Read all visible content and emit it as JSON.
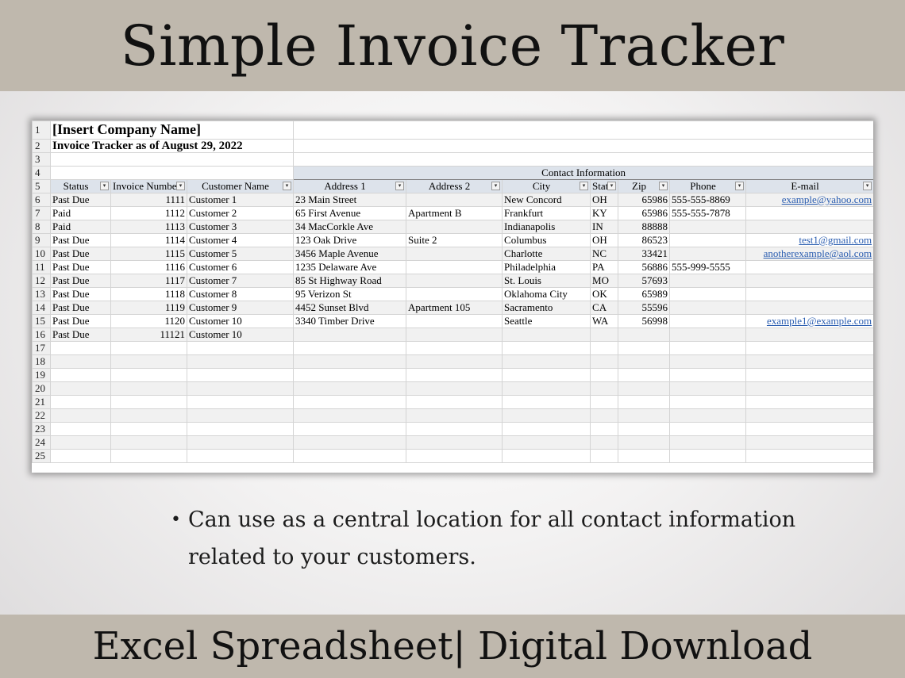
{
  "header": {
    "title": "Simple Invoice Tracker"
  },
  "footer": {
    "text": "Excel Spreadsheet| Digital Download"
  },
  "bullet": {
    "line1": "Can use as a central location for all contact information",
    "line2": "related to your customers."
  },
  "sheet": {
    "company": "[Insert Company Name]",
    "subtitle": "Invoice Tracker as of August 29, 2022",
    "group_header": "Contact Information",
    "headers": [
      "Status",
      "Invoice Numbe",
      "Customer Name",
      "Address 1",
      "Address 2",
      "City",
      "Stat",
      "Zip",
      "Phone",
      "E-mail"
    ],
    "rows": [
      [
        "Past Due",
        "1111",
        "Customer 1",
        "23 Main Street",
        "",
        "New Concord",
        "OH",
        "65986",
        "555-555-8869",
        "example@yahoo.com"
      ],
      [
        "Paid",
        "1112",
        "Customer 2",
        "65 First Avenue",
        "Apartment B",
        "Frankfurt",
        "KY",
        "65986",
        "555-555-7878",
        ""
      ],
      [
        "Paid",
        "1113",
        "Customer 3",
        "34 MacCorkle Ave",
        "",
        "Indianapolis",
        "IN",
        "88888",
        "",
        ""
      ],
      [
        "Past Due",
        "1114",
        "Customer 4",
        "123 Oak Drive",
        "Suite 2",
        "Columbus",
        "OH",
        "86523",
        "",
        "test1@gmail.com"
      ],
      [
        "Past Due",
        "1115",
        "Customer 5",
        "3456 Maple Avenue",
        "",
        "Charlotte",
        "NC",
        "33421",
        "",
        "anotherexample@aol.com"
      ],
      [
        "Past Due",
        "1116",
        "Customer 6",
        "1235 Delaware Ave",
        "",
        "Philadelphia",
        "PA",
        "56886",
        "555-999-5555",
        ""
      ],
      [
        "Past Due",
        "1117",
        "Customer 7",
        "85 St Highway Road",
        "",
        "St. Louis",
        "MO",
        "57693",
        "",
        ""
      ],
      [
        "Past Due",
        "1118",
        "Customer 8",
        "95 Verizon St",
        "",
        "Oklahoma City",
        "OK",
        "65989",
        "",
        ""
      ],
      [
        "Past Due",
        "1119",
        "Customer 9",
        "4452 Sunset Blvd",
        "Apartment 105",
        "Sacramento",
        "CA",
        "55596",
        "",
        ""
      ],
      [
        "Past Due",
        "1120",
        "Customer 10",
        "3340 Timber Drive",
        "",
        "Seattle",
        "WA",
        "56998",
        "",
        "example1@example.com"
      ],
      [
        "Past Due",
        "11121",
        "Customer 10",
        "",
        "",
        "",
        "",
        "",
        "",
        ""
      ]
    ],
    "row_numbers": [
      "1",
      "2",
      "3",
      "4",
      "5",
      "6",
      "7",
      "8",
      "9",
      "10",
      "11",
      "12",
      "13",
      "14",
      "15",
      "16",
      "17",
      "18",
      "19",
      "20",
      "21",
      "22",
      "23",
      "24",
      "25"
    ],
    "dropdown_glyph": "▾"
  }
}
